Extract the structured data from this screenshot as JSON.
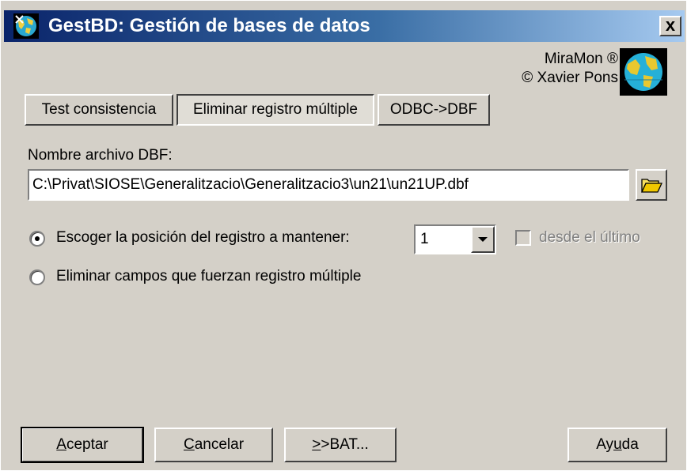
{
  "window": {
    "title": "GestBD: Gestión de bases de datos",
    "close_label": "x",
    "icon": "app-globe-icon"
  },
  "brand": {
    "line1": "MiraMon ®",
    "line2": "© Xavier Pons",
    "logo": "miramon-globe-logo"
  },
  "tabs": {
    "test": "Test consistencia",
    "eliminar": "Eliminar registro múltiple",
    "odbc": "ODBC->DBF",
    "active": "eliminar"
  },
  "file": {
    "label": "Nombre archivo DBF:",
    "value": "C:\\Privat\\SIOSE\\Generalitzacio\\Generalitzacio3\\un21\\un21UP.dbf",
    "browse_icon": "folder-open-icon"
  },
  "options": {
    "radio1_label": "Escoger la posición del registro a mantener:",
    "radio1_checked": true,
    "position_value": "1",
    "from_last_label": "desde el último",
    "from_last_checked": false,
    "radio2_label": "Eliminar campos que fuerzan registro múltiple",
    "radio2_checked": false
  },
  "buttons": {
    "accept_prefix": "A",
    "accept_rest": "ceptar",
    "cancel_prefix": "C",
    "cancel_rest": "ancelar",
    "bat_prefix": ">",
    "bat_rest": ">BAT...",
    "help_prefix": "Ay",
    "help_mnemonic": "u",
    "help_rest": "da"
  }
}
